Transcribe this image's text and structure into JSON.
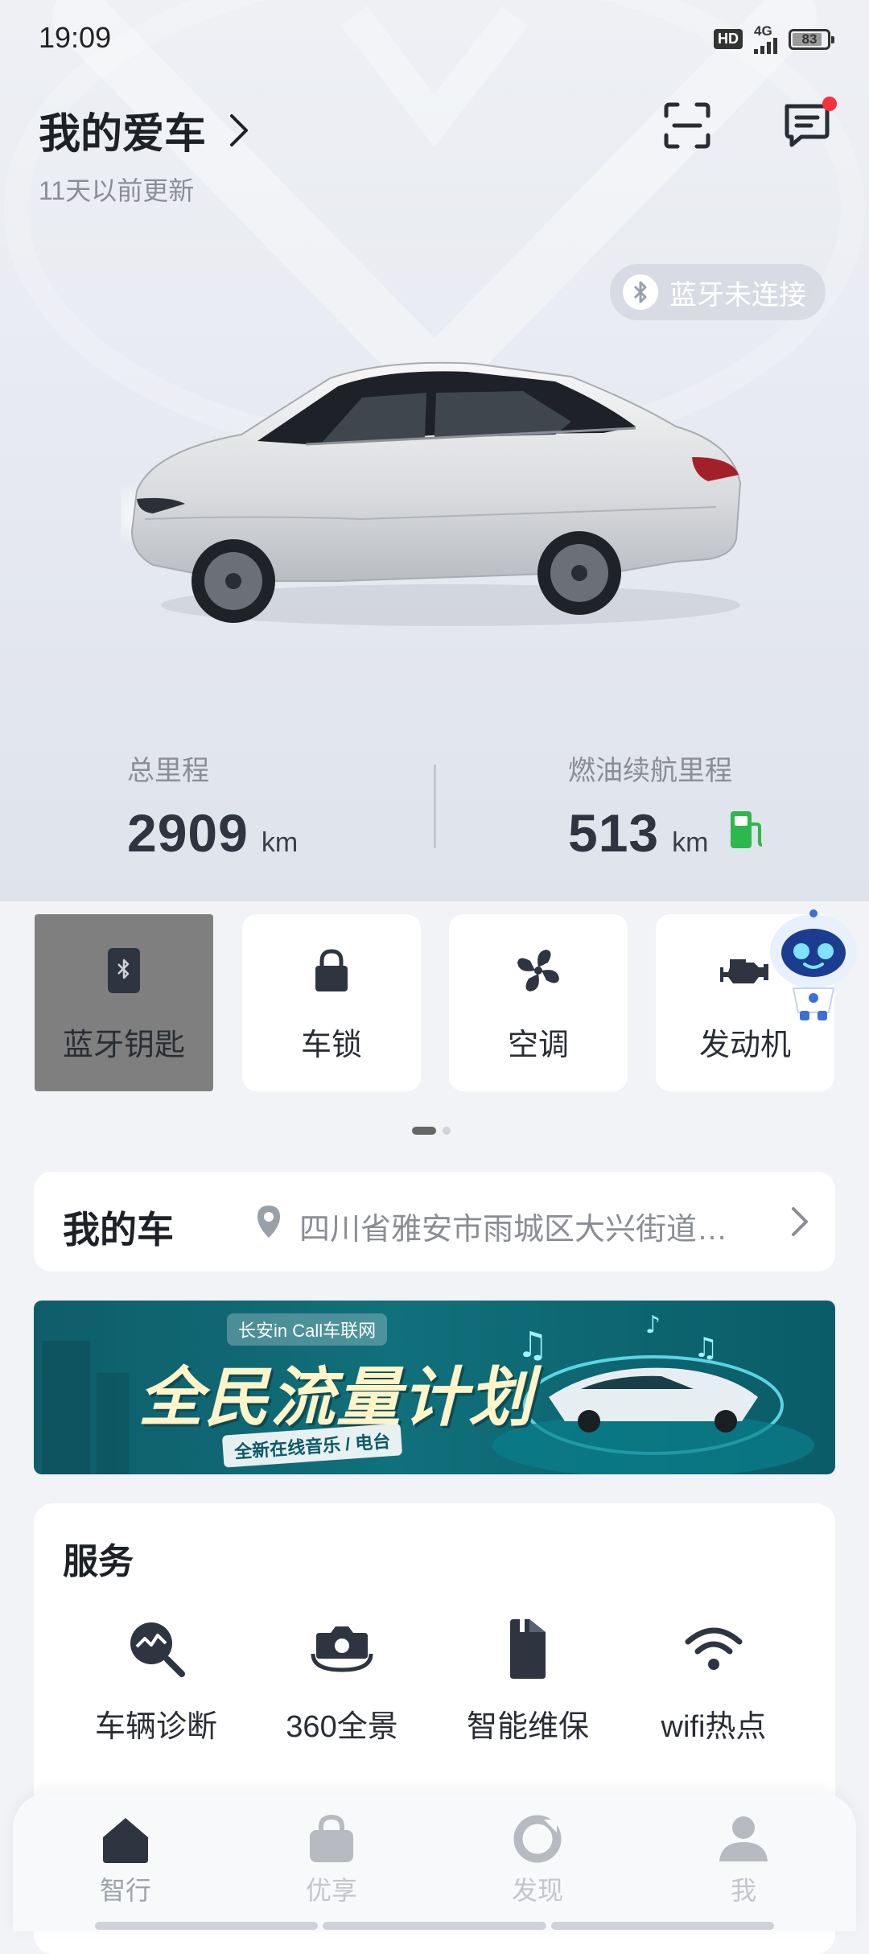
{
  "status_bar": {
    "time": "19:09",
    "hd": "HD",
    "network": "4G",
    "battery": "83"
  },
  "header": {
    "title": "我的爱车",
    "updated": "11天以前更新"
  },
  "bluetooth_status": "蓝牙未连接",
  "stats": {
    "total_mileage": {
      "label": "总里程",
      "value": "2909",
      "unit": "km"
    },
    "fuel_range": {
      "label": "燃油续航里程",
      "value": "513",
      "unit": "km"
    }
  },
  "quick_controls": [
    {
      "label": "蓝牙钥匙",
      "icon": "bluetooth-key-icon"
    },
    {
      "label": "车锁",
      "icon": "lock-icon"
    },
    {
      "label": "空调",
      "icon": "fan-icon"
    },
    {
      "label": "发动机",
      "icon": "engine-icon"
    }
  ],
  "my_car": {
    "title": "我的车",
    "address": "四川省雅安市雨城区大兴街道…"
  },
  "banner": {
    "tag": "长安in Call车联网",
    "headline": "全民流量计划",
    "subline": "全新在线音乐 / 电台"
  },
  "services": {
    "title": "服务",
    "items": [
      {
        "label": "车辆诊断",
        "icon": "diagnosis-icon"
      },
      {
        "label": "360全景",
        "icon": "camera-360-icon"
      },
      {
        "label": "智能维保",
        "icon": "maintenance-icon"
      },
      {
        "label": "wifi热点",
        "icon": "wifi-icon"
      }
    ]
  },
  "tabs": [
    {
      "label": "智行",
      "icon": "home-icon",
      "active": true
    },
    {
      "label": "优享",
      "icon": "bag-icon",
      "active": false
    },
    {
      "label": "发现",
      "icon": "discover-icon",
      "active": false
    },
    {
      "label": "我",
      "icon": "profile-icon",
      "active": false
    }
  ],
  "colors": {
    "accent_dark": "#2e3440",
    "fuel_green": "#2db84d",
    "badge_red": "#f2323c"
  }
}
